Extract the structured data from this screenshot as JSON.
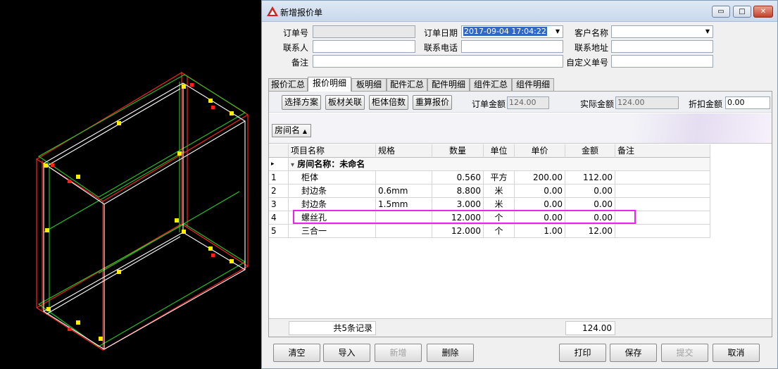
{
  "window": {
    "title": "新增报价单",
    "minimize_symbol": "▭",
    "maximize_symbol": "□",
    "close_symbol": "✕"
  },
  "header": {
    "order_no_label": "订单号",
    "order_no_value": "",
    "order_date_label": "订单日期",
    "order_date_value": "2017-09-04 17:04:22",
    "customer_label": "客户名称",
    "customer_value": "",
    "contact_label": "联系人",
    "contact_value": "",
    "phone_label": "联系电话",
    "phone_value": "",
    "address_label": "联系地址",
    "address_value": "",
    "remark_label": "备注",
    "remark_value": "",
    "custom_no_label": "自定义单号",
    "custom_no_value": ""
  },
  "tabs": [
    {
      "label": "报价汇总"
    },
    {
      "label": "报价明细"
    },
    {
      "label": "板明细"
    },
    {
      "label": "配件汇总"
    },
    {
      "label": "配件明细"
    },
    {
      "label": "组件汇总"
    },
    {
      "label": "组件明细"
    }
  ],
  "active_tab": "报价明细",
  "toolbar": {
    "select_scheme": "选择方案",
    "board_link": "板材关联",
    "cabinet_multiple": "柜体倍数",
    "recalc": "重算报价",
    "order_amount_label": "订单金额",
    "order_amount_value": "124.00",
    "actual_amount_label": "实际金额",
    "actual_amount_value": "124.00",
    "discount_label": "折扣金额",
    "discount_value": "0.00"
  },
  "group_chip": {
    "label": "房间名",
    "sort_symbol": "▲"
  },
  "grid": {
    "columns": [
      "",
      "项目名称",
      "规格",
      "数量",
      "单位",
      "单价",
      "金额",
      "备注"
    ],
    "group_marker": "▸",
    "group_row": {
      "expander": "▾",
      "label": "房间名称：未命名"
    },
    "rows": [
      {
        "no": "1",
        "name": "柜体",
        "spec": "",
        "qty": "0.560",
        "unit": "平方",
        "price": "200.00",
        "amount": "112.00",
        "remark": ""
      },
      {
        "no": "2",
        "name": "封边条",
        "spec": "0.6mm",
        "qty": "8.800",
        "unit": "米",
        "price": "0.00",
        "amount": "0.00",
        "remark": ""
      },
      {
        "no": "3",
        "name": "封边条",
        "spec": "1.5mm",
        "qty": "3.000",
        "unit": "米",
        "price": "0.00",
        "amount": "0.00",
        "remark": ""
      },
      {
        "no": "4",
        "name": "螺丝孔",
        "spec": "",
        "qty": "12.000",
        "unit": "个",
        "price": "0.00",
        "amount": "0.00",
        "remark": ""
      },
      {
        "no": "5",
        "name": "三合一",
        "spec": "",
        "qty": "12.000",
        "unit": "个",
        "price": "1.00",
        "amount": "12.00",
        "remark": ""
      }
    ],
    "footer_count": "共5条记录",
    "footer_total": "124.00"
  },
  "buttons": {
    "clear": "清空",
    "import": "导入",
    "add": "新增",
    "delete": "删除",
    "print": "打印",
    "save": "保存",
    "submit": "提交",
    "cancel": "取消"
  },
  "colors": {
    "highlight": "#ee22ee",
    "cad_red": "#ff2020",
    "cad_green": "#22cc22",
    "cad_yellow": "#ffee00"
  }
}
